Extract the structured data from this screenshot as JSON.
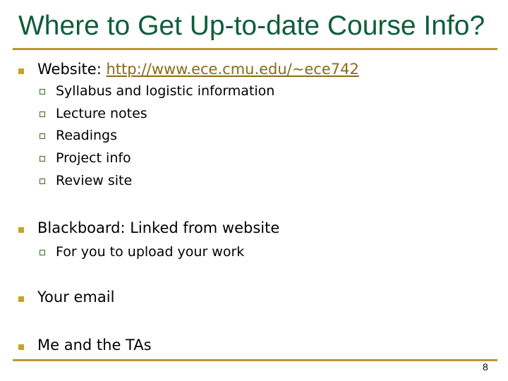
{
  "slide": {
    "title": "Where to Get Up-to-date Course Info?",
    "page_number": "8"
  },
  "bullets": [
    {
      "label": "Website:",
      "link": "http://www.ece.cmu.edu/~ece742",
      "children": [
        "Syllabus and logistic information",
        "Lecture notes",
        "Readings",
        "Project info",
        "Review site"
      ]
    },
    {
      "label": "Blackboard: Linked from website",
      "children": [
        "For you to upload your work"
      ]
    },
    {
      "label": "Your email"
    },
    {
      "label": "Me and the TAs"
    }
  ],
  "colors": {
    "title": "#0f5d3a",
    "rule": "#b8972f",
    "bullet": "#c9a227",
    "link": "#8a6a14"
  }
}
